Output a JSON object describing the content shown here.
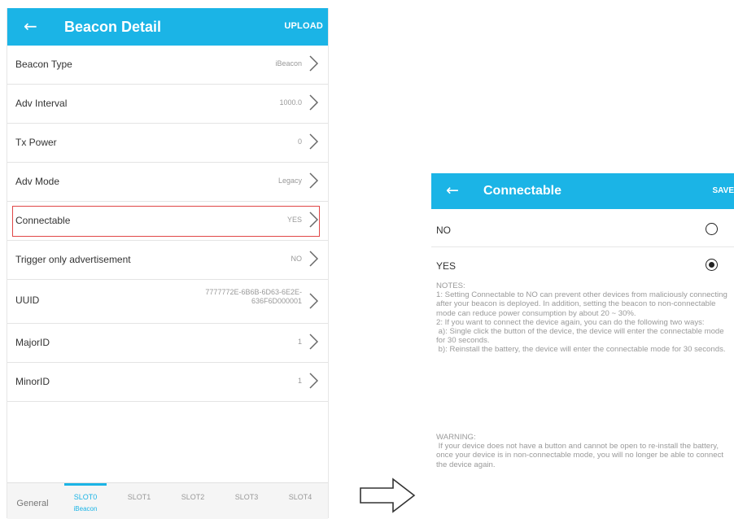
{
  "left_screen": {
    "header": {
      "title": "Beacon Detail",
      "action": "UPLOAD"
    },
    "rows": [
      {
        "label": "Beacon Type",
        "value": "iBeacon"
      },
      {
        "label": "Adv Interval",
        "value": "1000.0"
      },
      {
        "label": "Tx Power",
        "value": "0"
      },
      {
        "label": "Adv Mode",
        "value": "Legacy"
      },
      {
        "label": "Connectable",
        "value": "YES"
      },
      {
        "label": "Trigger only advertisement",
        "value": "NO"
      },
      {
        "label": "UUID",
        "value": "7777772E-6B6B-6D63-6E2E-636F6D000001"
      },
      {
        "label": "MajorID",
        "value": "1"
      },
      {
        "label": "MinorID",
        "value": "1"
      }
    ],
    "tabs": {
      "general": "General",
      "slot0": "SLOT0",
      "slot0_sub": "iBeacon",
      "slot1": "SLOT1",
      "slot2": "SLOT2",
      "slot3": "SLOT3",
      "slot4": "SLOT4"
    }
  },
  "right_screen": {
    "header": {
      "title": "Connectable",
      "action": "SAVE"
    },
    "options": [
      {
        "label": "NO",
        "selected": false
      },
      {
        "label": "YES",
        "selected": true
      }
    ],
    "notes": "NOTES:\n1: Setting Connectable to NO can prevent other devices from maliciously connecting after your beacon is deployed. In addition, setting the beacon to non-connectable mode can reduce power consumption by about 20 ~ 30%.\n2: If you want to connect the device again, you can do the following two ways:\n a): Single click the button of the device, the device will enter the connectable mode for 30 seconds.\n b): Reinstall the battery, the device will enter the connectable mode for 30 seconds.",
    "warning": "WARNING:\n If your device does not have a button and cannot be open to re-install the battery, once your device is in non-connectable mode, you will no longer be able to connect the device again."
  },
  "colors": {
    "accent": "#1bb4e6",
    "highlight_border": "#e04646"
  },
  "icons": [
    "back-arrow-icon",
    "chevron-right-icon",
    "radio-unselected-icon",
    "radio-selected-icon",
    "right-arrow-icon"
  ]
}
